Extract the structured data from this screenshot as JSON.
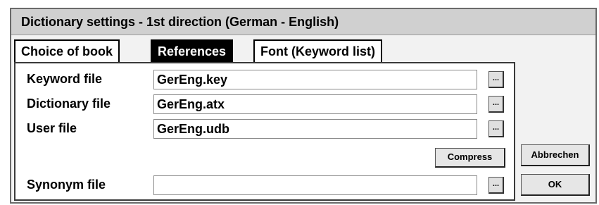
{
  "window": {
    "title": "Dictionary settings - 1st direction (German - English)"
  },
  "tabs": [
    {
      "label": "Choice of book"
    },
    {
      "label": "References"
    },
    {
      "label": "Font (Keyword list)"
    }
  ],
  "form": {
    "keyword": {
      "label": "Keyword file",
      "value": "GerEng.key",
      "browse": "..."
    },
    "dictionary": {
      "label": "Dictionary file",
      "value": "GerEng.atx",
      "browse": "..."
    },
    "user": {
      "label": "User file",
      "value": "GerEng.udb",
      "browse": "..."
    },
    "compress_label": "Compress",
    "synonym": {
      "label": "Synonym file",
      "value": "",
      "browse": "..."
    }
  },
  "buttons": {
    "cancel": "Abbrechen",
    "ok": "OK"
  }
}
